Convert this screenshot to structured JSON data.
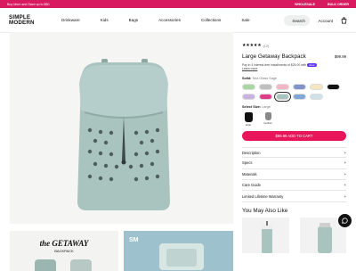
{
  "promo": {
    "text": "Buy More and Save up to $50",
    "wholesale": "WHOLESALE",
    "bulk": "BULK ORDER"
  },
  "header": {
    "logo_line1": "SIMPLE",
    "logo_line2": "MODERN",
    "nav": [
      "Drinkware",
      "Kids",
      "Bags",
      "Accessories",
      "Collections",
      "Sale"
    ],
    "search_label": "Search",
    "account_label": "Account"
  },
  "gallery": {
    "thumb1_brand": "the GETAWAY",
    "thumb1_sub": "BACKPACK",
    "thumb2_text": "SM"
  },
  "product": {
    "stars": "★★★★★",
    "review_count": "(12)",
    "title": "Large Getaway Backpack",
    "price": "$99.99",
    "afterpay_text": "Pay in 4 interest-free installments of $25.00 with",
    "afterpay_badge": "shop",
    "learn_more": "Learn more",
    "color_label": "Solid:",
    "color_value": "Sea Glass Sage",
    "size_label": "Select Size:",
    "size_value": "Large",
    "sizes": [
      {
        "label": "large",
        "color": "#111111"
      },
      {
        "label": "medium",
        "color": "#888888"
      }
    ],
    "cart_button": "$99.99 ADD TO CART",
    "swatches": [
      "#a8d8a0",
      "#bfbfbf",
      "#f2b6c6",
      "#7f95c9",
      "#f5e6c0",
      "#111111",
      "#c9b2e2",
      "#e03c8a",
      "#a9c3bf",
      "#7fa7d6",
      "#cfe2e8"
    ],
    "accordion": [
      "Description",
      "Specs",
      "Materials",
      "Care Guide",
      "Limited Lifetime Warranty"
    ],
    "accordion_icon": "+",
    "you_may_also_like": "You May Also Like"
  },
  "colors": {
    "accent": "#e8155b",
    "promo": "#d81b60",
    "bag": "#a9c3bf"
  }
}
